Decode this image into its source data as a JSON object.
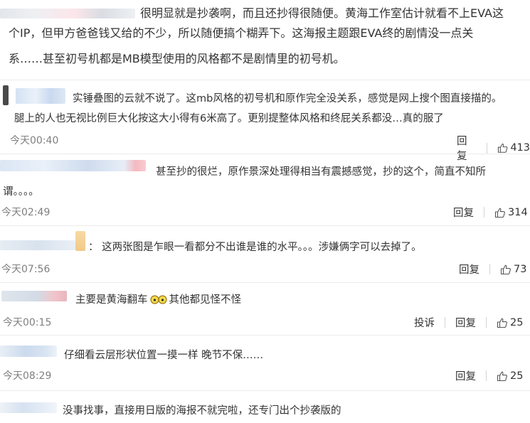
{
  "top_comment": {
    "lines": [
      "很明显就是抄袭啊，而且还抄得很随便。黄海工作室估计就看不上EVA这",
      "个IP，但甲方爸爸钱又给的不少，所以随便搞个糊弄下。这海报主题跟EVA终的剧情没一点关",
      "系……甚至初号机都是MB模型使用的风格都不是剧情里的初号机。"
    ]
  },
  "comments": [
    {
      "lines": [
        "实锤叠图的云就不说了。这mb风格的初号机和原作完全没关系，感觉是网上搜个图直接描的。",
        "腿上的人也无视比例巨大化按这大小得有6米高了。更别提整体风格和终屁关系都没…真的服了"
      ],
      "time": "今天00:40",
      "reply": "回复",
      "likes": "413"
    },
    {
      "lines": [
        "甚至抄的很烂，原作景深处理得相当有震撼感觉，抄的这个，简直不知所",
        "谓。。。。"
      ],
      "time": "今天02:49",
      "reply": "回复",
      "likes": "314"
    },
    {
      "lines": [
        "： 这两张图是乍眼一看都分不出谁是谁的水平。。。涉嫌俩字可以去掉了。"
      ],
      "time": "今天07:56",
      "reply": "回复",
      "likes": "73"
    },
    {
      "text_before": "主要是黄海翻车",
      "text_after": "其他都见怪不怪",
      "emoji": "glasses-emoji",
      "time": "今天00:15",
      "report": "投诉",
      "reply": "回复",
      "likes": "25"
    },
    {
      "lines": [
        "仔细看云层形状位置一摸一样 晚节不保……"
      ],
      "time": "今天08:29",
      "reply": "回复",
      "likes": "25"
    },
    {
      "lines": [
        "没事找事，直接用日版的海报不就完啦，还专门出个抄袭版的"
      ]
    }
  ],
  "colors": {
    "text": "#333333",
    "meta": "#808080",
    "divider": "#ececec",
    "blur_blue": "#c9d9ef",
    "blur_pink": "#f4c2c6",
    "blur_orange": "#f6d9a6"
  }
}
